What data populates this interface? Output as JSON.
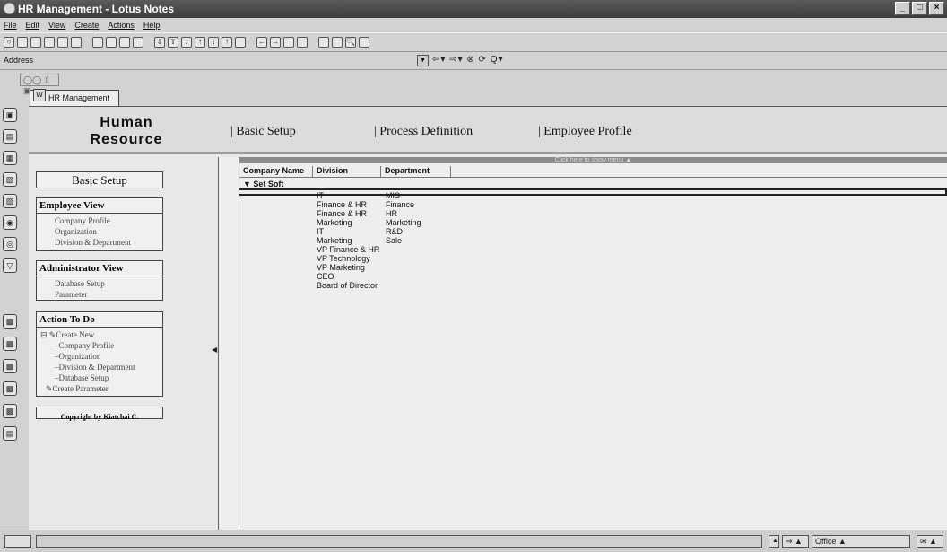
{
  "window": {
    "title": "HR Management - Lotus Notes"
  },
  "menu": [
    "File",
    "Edit",
    "View",
    "Create",
    "Actions",
    "Help"
  ],
  "address": {
    "label": "Address"
  },
  "doc_tab": {
    "label": "HR Management"
  },
  "header": {
    "logo_line1": "Human",
    "logo_line2": "Resource",
    "nav": [
      "| Basic Setup",
      "| Process Definition",
      "| Employee Profile"
    ]
  },
  "sidebar": {
    "basic_setup": "Basic Setup",
    "employee_view": {
      "title": "Employee View",
      "items": [
        "Company Profile",
        "Organization",
        "Division & Department"
      ]
    },
    "admin_view": {
      "title": "Administrator View",
      "items": [
        "Database Setup",
        "Parameter"
      ]
    },
    "action": {
      "title": "Action To Do",
      "create_new": "Create New",
      "items": [
        "Company Profile",
        "Organization",
        "Division & Department",
        "Database Setup"
      ],
      "create_parameter": "Create Parameter"
    },
    "copyright": "Copyright by Kiatchai C."
  },
  "view": {
    "show_menu": "Click here to show menu ▲",
    "columns": [
      "Company Name",
      "Division",
      "Department"
    ],
    "category": "▼ Set Soft",
    "divisions": [
      "IT",
      "Finance & HR",
      "Finance & HR",
      "Marketing",
      "IT",
      "Marketing",
      "VP Finance & HR",
      "VP Technology",
      "VP Marketing",
      "CEO",
      "Board of Director"
    ],
    "departments": [
      "MIS",
      "Finance",
      "HR",
      "Marketing",
      "R&D",
      "Sale"
    ]
  },
  "statusbar": {
    "office": "Office"
  }
}
